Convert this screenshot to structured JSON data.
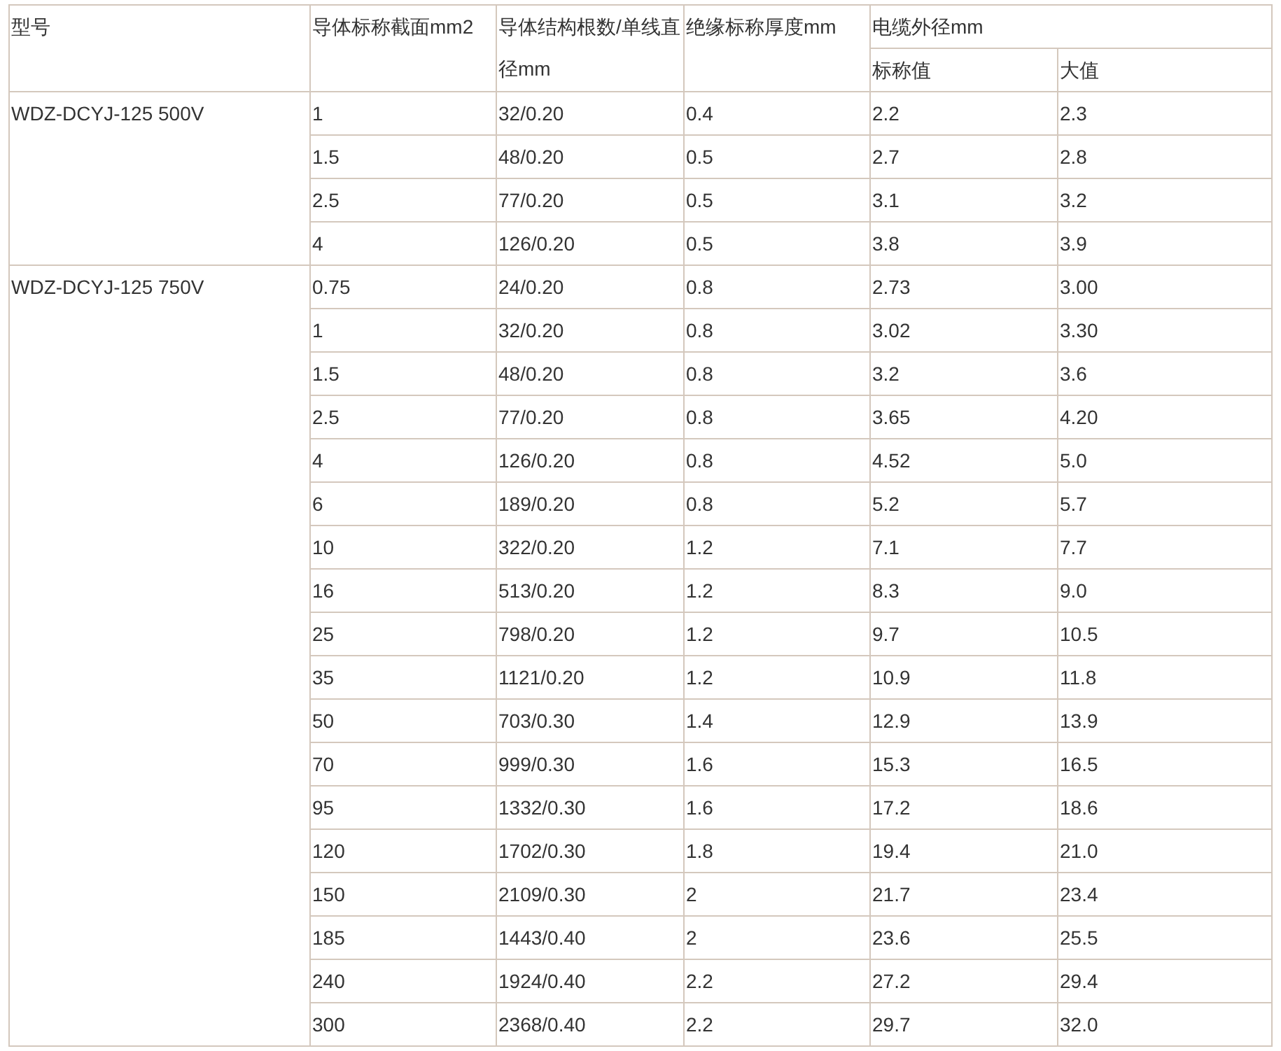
{
  "table": {
    "columns": [
      "型号",
      "导体标称截面mm2",
      "导体结构根数/单线直径mm",
      "绝缘标称厚度mm",
      "电缆外径mm"
    ],
    "subcolumns": [
      "标称值",
      "大值"
    ],
    "groups": [
      {
        "model": "WDZ-DCYJ-125 500V",
        "rows": [
          [
            "1",
            "32/0.20",
            "0.4",
            "2.2",
            "2.3"
          ],
          [
            "1.5",
            "48/0.20",
            "0.5",
            "2.7",
            "2.8"
          ],
          [
            "2.5",
            "77/0.20",
            "0.5",
            "3.1",
            "3.2"
          ],
          [
            "4",
            "126/0.20",
            "0.5",
            "3.8",
            "3.9"
          ]
        ]
      },
      {
        "model": "WDZ-DCYJ-125 750V",
        "rows": [
          [
            "0.75",
            "24/0.20",
            "0.8",
            "2.73",
            "3.00"
          ],
          [
            "1",
            "32/0.20",
            "0.8",
            "3.02",
            "3.30"
          ],
          [
            "1.5",
            "48/0.20",
            "0.8",
            "3.2",
            "3.6"
          ],
          [
            "2.5",
            "77/0.20",
            "0.8",
            "3.65",
            "4.20"
          ],
          [
            "4",
            "126/0.20",
            "0.8",
            "4.52",
            "5.0"
          ],
          [
            "6",
            "189/0.20",
            "0.8",
            "5.2",
            "5.7"
          ],
          [
            "10",
            "322/0.20",
            "1.2",
            "7.1",
            "7.7"
          ],
          [
            "16",
            "513/0.20",
            "1.2",
            "8.3",
            "9.0"
          ],
          [
            "25",
            "798/0.20",
            "1.2",
            "9.7",
            "10.5"
          ],
          [
            "35",
            "1121/0.20",
            "1.2",
            "10.9",
            "11.8"
          ],
          [
            "50",
            "703/0.30",
            "1.4",
            "12.9",
            "13.9"
          ],
          [
            "70",
            "999/0.30",
            "1.6",
            "15.3",
            "16.5"
          ],
          [
            "95",
            "1332/0.30",
            "1.6",
            "17.2",
            "18.6"
          ],
          [
            "120",
            "1702/0.30",
            "1.8",
            "19.4",
            "21.0"
          ],
          [
            "150",
            "2109/0.30",
            "2",
            "21.7",
            "23.4"
          ],
          [
            "185",
            "1443/0.40",
            "2",
            "23.6",
            "25.5"
          ],
          [
            "240",
            "1924/0.40",
            "2.2",
            "27.2",
            "29.4"
          ],
          [
            "300",
            "2368/0.40",
            "2.2",
            "29.7",
            "32.0"
          ]
        ]
      }
    ]
  }
}
